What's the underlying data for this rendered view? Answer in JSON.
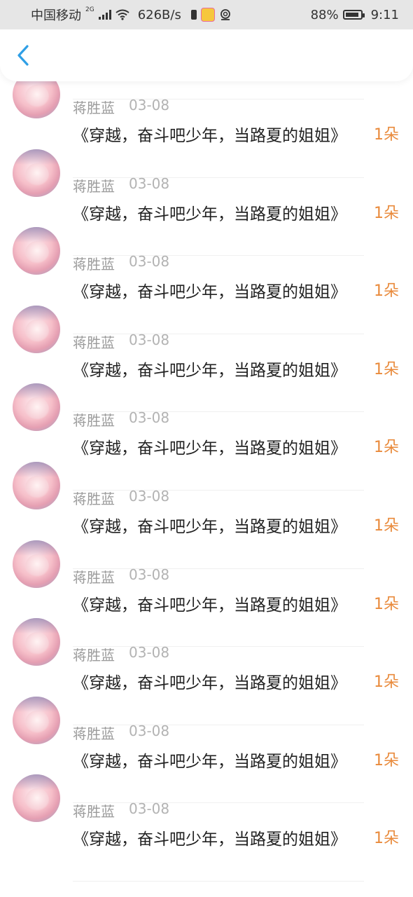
{
  "status_bar": {
    "carrier": "中国移动",
    "network_tag": "2G",
    "speed": "626B/s",
    "battery": "88%",
    "time": "9:11"
  },
  "header": {
    "back_icon": "chevron-left-icon"
  },
  "items": [
    {
      "name": "蒋胜蓝",
      "date": "03-08",
      "title": "《穿越，奋斗吧少年，当路夏的姐姐》",
      "count": "1朵"
    },
    {
      "name": "蒋胜蓝",
      "date": "03-08",
      "title": "《穿越，奋斗吧少年，当路夏的姐姐》",
      "count": "1朵"
    },
    {
      "name": "蒋胜蓝",
      "date": "03-08",
      "title": "《穿越，奋斗吧少年，当路夏的姐姐》",
      "count": "1朵"
    },
    {
      "name": "蒋胜蓝",
      "date": "03-08",
      "title": "《穿越，奋斗吧少年，当路夏的姐姐》",
      "count": "1朵"
    },
    {
      "name": "蒋胜蓝",
      "date": "03-08",
      "title": "《穿越，奋斗吧少年，当路夏的姐姐》",
      "count": "1朵"
    },
    {
      "name": "蒋胜蓝",
      "date": "03-08",
      "title": "《穿越，奋斗吧少年，当路夏的姐姐》",
      "count": "1朵"
    },
    {
      "name": "蒋胜蓝",
      "date": "03-08",
      "title": "《穿越，奋斗吧少年，当路夏的姐姐》",
      "count": "1朵"
    },
    {
      "name": "蒋胜蓝",
      "date": "03-08",
      "title": "《穿越，奋斗吧少年，当路夏的姐姐》",
      "count": "1朵"
    },
    {
      "name": "蒋胜蓝",
      "date": "03-08",
      "title": "《穿越，奋斗吧少年，当路夏的姐姐》",
      "count": "1朵"
    },
    {
      "name": "蒋胜蓝",
      "date": "03-08",
      "title": "《穿越，奋斗吧少年，当路夏的姐姐》",
      "count": "1朵"
    }
  ],
  "colors": {
    "accent": "#e98a3b",
    "back_icon": "#2f9fe6",
    "name": "#9b9b9b",
    "title": "#222222"
  }
}
